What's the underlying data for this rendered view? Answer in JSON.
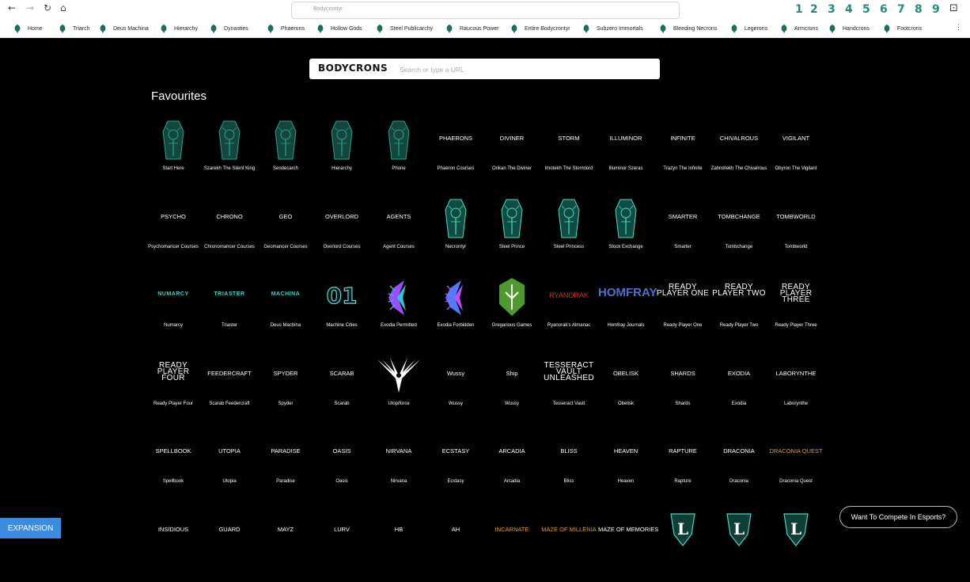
{
  "browser": {
    "url_text": "Bodycrontyr",
    "extension_numbers": [
      "1",
      "2",
      "3",
      "4",
      "5",
      "6",
      "7",
      "8",
      "9"
    ],
    "accent_color": "#1d8f7e"
  },
  "bookmarks": [
    "Home",
    "Triarch",
    "Deus Machina",
    "Hierarchy",
    "Dynasties",
    "Phaerons",
    "Hollow Gods",
    "Steel Publicarchy",
    "Raucous Power",
    "Entire Bodycrontyr",
    "Subzero Immortals",
    "Bleeding Necrons",
    "Legerons",
    "Armcrons",
    "Handcrons",
    "Footcrons"
  ],
  "search": {
    "brand": "BODYCRONS",
    "placeholder": "Search or type a URL"
  },
  "favourites": {
    "title": "Favourites",
    "items": [
      {
        "logo": "coffin-icon",
        "logo_text": "",
        "caption": "Start Here"
      },
      {
        "logo": "coffin-icon",
        "logo_text": "",
        "caption": "Szarekh The Silent King"
      },
      {
        "logo": "coffin-icon",
        "logo_text": "",
        "caption": "Seodecarch"
      },
      {
        "logo": "coffin-icon",
        "logo_text": "",
        "caption": "Hierarchy"
      },
      {
        "logo": "coffin-icon",
        "logo_text": "",
        "caption": "Phone"
      },
      {
        "logo": "text",
        "logo_text": "PHAERONS",
        "caption": "Phaeron Courses"
      },
      {
        "logo": "text",
        "logo_text": "DIVINER",
        "caption": "Orikan The Diviner"
      },
      {
        "logo": "text",
        "logo_text": "STORM",
        "caption": "Imotekh The Stormlord"
      },
      {
        "logo": "text",
        "logo_text": "ILLUMINOR",
        "caption": "Illuminor Szeras"
      },
      {
        "logo": "text",
        "logo_text": "INFINITE",
        "caption": "Trazyn The Infinite"
      },
      {
        "logo": "text",
        "logo_text": "CHIVALROUS",
        "caption": "Zahndrekh The Chivalrous"
      },
      {
        "logo": "text",
        "logo_text": "VIGILANT",
        "caption": "Obyron The Vigilant"
      },
      {
        "logo": "text",
        "logo_text": "PSYCHO",
        "caption": "Psychomancer Courses"
      },
      {
        "logo": "text",
        "logo_text": "CHRONO",
        "caption": "Chronomancer Courses"
      },
      {
        "logo": "text",
        "logo_text": "GEO",
        "caption": "Geomancer Courses"
      },
      {
        "logo": "text",
        "logo_text": "OVERLORD",
        "caption": "Overlord Courses"
      },
      {
        "logo": "text",
        "logo_text": "AGENTS",
        "caption": "Agent Courses"
      },
      {
        "logo": "green-coffin-icon",
        "logo_text": "",
        "caption": "Necrontyr"
      },
      {
        "logo": "green-coffin-icon",
        "logo_text": "",
        "caption": "Steel Prince"
      },
      {
        "logo": "green-coffin-icon",
        "logo_text": "",
        "caption": "Steel Princess"
      },
      {
        "logo": "green-coffin-icon",
        "logo_text": "",
        "caption": "Stock Exchange"
      },
      {
        "logo": "text",
        "logo_text": "SMARTER",
        "caption": "Smarter"
      },
      {
        "logo": "text",
        "logo_text": "TOMBCHANGE",
        "caption": "Tombchange"
      },
      {
        "logo": "text",
        "logo_text": "TOMBWORLD",
        "caption": "Tombworld"
      },
      {
        "logo": "text-teal",
        "logo_text": "NUMARCY",
        "caption": "Numarcy"
      },
      {
        "logo": "text-teal",
        "logo_text": "TRIASTER",
        "caption": "Triaster"
      },
      {
        "logo": "text-teal",
        "logo_text": "MACHINA",
        "caption": "Deus Machina"
      },
      {
        "logo": "o1-icon",
        "logo_text": "01",
        "caption": "Machine Cities"
      },
      {
        "logo": "exodia-permitted-icon",
        "logo_text": "",
        "caption": "Exodia Permitted"
      },
      {
        "logo": "exodia-forbidden-icon",
        "logo_text": "",
        "caption": "Exodia Forbidden"
      },
      {
        "logo": "gregarious-shield-icon",
        "logo_text": "",
        "caption": "Gregarious Games"
      },
      {
        "logo": "text-red",
        "logo_text": "RYANORAK",
        "caption": "Ryanorak's Almanac"
      },
      {
        "logo": "text-blue",
        "logo_text": "HOMFRAY",
        "caption": "Homfray Journals"
      },
      {
        "logo": "text-stack",
        "logo_text": "READY PLAYER ONE",
        "caption": "Ready Player One"
      },
      {
        "logo": "text-stack",
        "logo_text": "READY PLAYER TWO",
        "caption": "Ready Player Two"
      },
      {
        "logo": "text-stack",
        "logo_text": "READY PLAYER THREE",
        "caption": "Ready Player Three"
      },
      {
        "logo": "text-stack",
        "logo_text": "READY PLAYER FOUR",
        "caption": "Ready Player Four"
      },
      {
        "logo": "text",
        "logo_text": "FEEDERCRAFT",
        "caption": "Scarab Feedercraft"
      },
      {
        "logo": "text",
        "logo_text": "SPYDER",
        "caption": "Spyder"
      },
      {
        "logo": "text",
        "logo_text": "SCARAB",
        "caption": "Scarab"
      },
      {
        "logo": "phoenix-icon",
        "logo_text": "",
        "caption": "Utopiforce"
      },
      {
        "logo": "text-script",
        "logo_text": "Wussy",
        "caption": "Wussy"
      },
      {
        "logo": "text-script",
        "logo_text": "Ship",
        "caption": "Wussy"
      },
      {
        "logo": "text-stack",
        "logo_text": "TESSERACT VAULT UNLEASHED",
        "caption": "Tesseract Vault"
      },
      {
        "logo": "text",
        "logo_text": "OBELISK",
        "caption": "Obelisk"
      },
      {
        "logo": "text",
        "logo_text": "SHARDS",
        "caption": "Shards"
      },
      {
        "logo": "text",
        "logo_text": "EXODIA",
        "caption": "Exodia"
      },
      {
        "logo": "text",
        "logo_text": "LABORYNTHE",
        "caption": "Laborynthe"
      },
      {
        "logo": "text",
        "logo_text": "SPELLBOOK",
        "caption": "Spellbook"
      },
      {
        "logo": "text",
        "logo_text": "UTOPIA",
        "caption": "Utopia"
      },
      {
        "logo": "text",
        "logo_text": "PARADISE",
        "caption": "Paradise"
      },
      {
        "logo": "text",
        "logo_text": "OASIS",
        "caption": "Oasis"
      },
      {
        "logo": "text",
        "logo_text": "NIRVANA",
        "caption": "Nirvana"
      },
      {
        "logo": "text",
        "logo_text": "ECSTASY",
        "caption": "Ecstasy"
      },
      {
        "logo": "text",
        "logo_text": "ARCADIA",
        "caption": "Arcadia"
      },
      {
        "logo": "text",
        "logo_text": "BLISS",
        "caption": "Bliss"
      },
      {
        "logo": "text",
        "logo_text": "HEAVEN",
        "caption": "Heaven"
      },
      {
        "logo": "text",
        "logo_text": "RAPTURE",
        "caption": "Rapture"
      },
      {
        "logo": "text",
        "logo_text": "DRACONIA",
        "caption": "Draconia"
      },
      {
        "logo": "text-gold",
        "logo_text": "DRACONIA QUEST",
        "caption": "Draconia Quest"
      },
      {
        "logo": "text",
        "logo_text": "INSIDIOUS",
        "caption": ""
      },
      {
        "logo": "text",
        "logo_text": "GUARD",
        "caption": ""
      },
      {
        "logo": "text",
        "logo_text": "MAYZ",
        "caption": ""
      },
      {
        "logo": "text",
        "logo_text": "LURV",
        "caption": ""
      },
      {
        "logo": "text",
        "logo_text": "HB",
        "caption": ""
      },
      {
        "logo": "text",
        "logo_text": "AH",
        "caption": ""
      },
      {
        "logo": "text-orange",
        "logo_text": "INCARNATE",
        "caption": ""
      },
      {
        "logo": "text-orange",
        "logo_text": "MAZE OF MILLENIA",
        "caption": ""
      },
      {
        "logo": "text",
        "logo_text": "MAZE OF MEMORIES",
        "caption": ""
      },
      {
        "logo": "shield-l-icon",
        "logo_text": "L",
        "caption": ""
      },
      {
        "logo": "shield-l-icon",
        "logo_text": "L",
        "caption": ""
      },
      {
        "logo": "shield-l-icon",
        "logo_text": "L",
        "caption": ""
      }
    ]
  },
  "buttons": {
    "expansion": "EXPANSION",
    "compete": "Want To Compete In Esports?"
  }
}
